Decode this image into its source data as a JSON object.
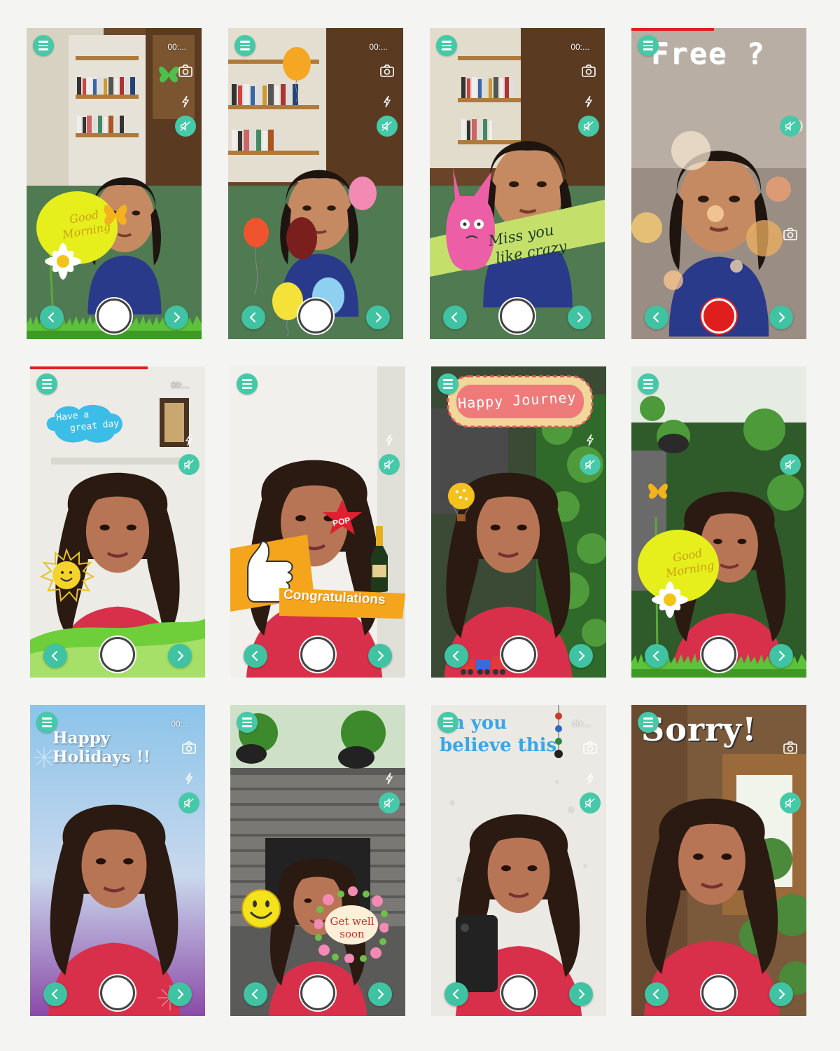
{
  "common": {
    "timer_text": "00:...",
    "icons": {
      "menu": "hamburger-menu-icon",
      "camera": "camera-switch-icon",
      "flash": "flash-icon",
      "mute": "sound-mute-icon",
      "prev": "chevron-left-icon",
      "next": "chevron-right-icon",
      "shutter": "shutter-button"
    },
    "accent_color": "#45c9a8",
    "record_color": "#e01e1e"
  },
  "screens": [
    {
      "sticker_lines": [
        "Good",
        "Morning"
      ]
    },
    {
      "sticker_lines": []
    },
    {
      "sticker_lines": [
        "Miss you",
        "like crazy"
      ]
    },
    {
      "sticker_lines": [
        "Free ?"
      ],
      "recording": true,
      "progress": 0.47
    },
    {
      "sticker_lines": [
        "Have a",
        "great day"
      ],
      "progress": 0.67
    },
    {
      "sticker_lines": [
        "POP",
        "Congratulations"
      ]
    },
    {
      "sticker_lines": [
        "Happy Journey"
      ]
    },
    {
      "sticker_lines": [
        "Good",
        "Morning"
      ]
    },
    {
      "sticker_lines": [
        "Happy Holidays !!"
      ]
    },
    {
      "sticker_lines": [
        "Get well",
        "soon"
      ]
    },
    {
      "sticker_lines": [
        "an you",
        "believe this"
      ]
    },
    {
      "sticker_lines": [
        "Sorry!"
      ]
    }
  ]
}
